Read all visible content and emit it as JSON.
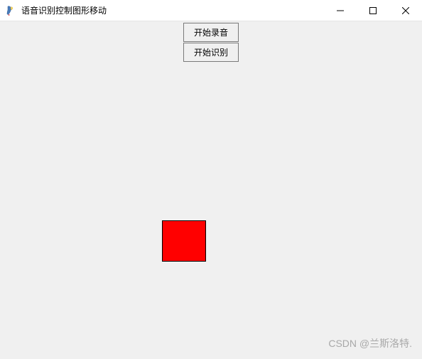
{
  "window": {
    "title": "语音识别控制图形移动"
  },
  "buttons": {
    "record": "开始录音",
    "recognize": "开始识别"
  },
  "shape": {
    "color": "#ff0000"
  },
  "watermark": {
    "text": "CSDN @兰斯洛特."
  },
  "controls": {
    "minimize": "—",
    "maximize": "☐",
    "close": "✕"
  }
}
